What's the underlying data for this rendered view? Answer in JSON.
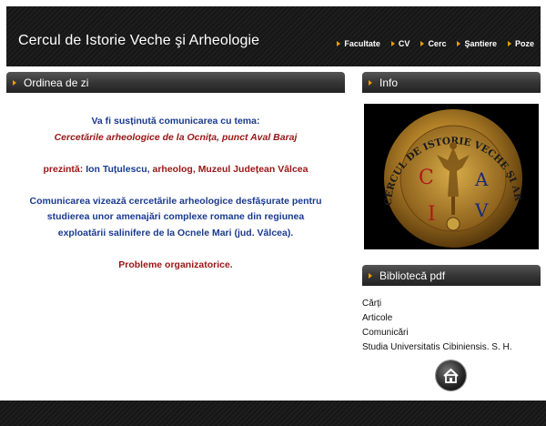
{
  "header": {
    "title": "Cercul de Istorie Veche şi Arheologie",
    "nav": [
      "Facultate",
      "CV",
      "Cerc",
      "Şantiere",
      "Poze"
    ]
  },
  "main": {
    "heading": "Ordinea de zi",
    "line1": "Va fi susținută comunicarea cu tema:",
    "line2": "Cercetările arheologice de la Ocnița, punct Aval Baraj",
    "presenter_label": "prezintă:",
    "presenter_name": "Ion Tuțulescu,",
    "presenter_role": "arheolog,",
    "presenter_inst": "Muzeul Județean Vâlcea",
    "desc1": "Comunicarea vizează cercetările arheologice desfășurate pentru",
    "desc2": "studierea unor amenajări complexe romane din regiunea",
    "desc3": "exploatării salinifere de la Ocnele Mari (jud. Vâlcea).",
    "closing": "Probleme organizatorice."
  },
  "info": {
    "heading": "Info",
    "logo": {
      "ring_text": "CERCUL DE ISTORIE VECHE ŞI ARHEOLOGIE \"VLADIMIR DUMITRESCU\"",
      "letters": [
        "C",
        "I",
        "A",
        "V"
      ]
    }
  },
  "library": {
    "heading": "Bibliotecă pdf",
    "items": [
      "Cărți",
      "Articole",
      "Comunicări",
      "Studia Universitatis Cibiniensis. S. H."
    ]
  },
  "icons": {
    "nav_arrow": "arrow-right-icon",
    "home": "home-icon"
  },
  "colors": {
    "accent": "#e5a000",
    "blue_text": "#1a3a8e",
    "red_text": "#9a1515"
  }
}
